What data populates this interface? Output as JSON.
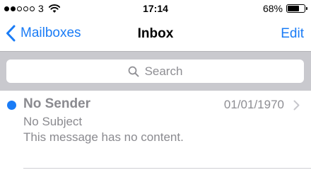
{
  "status_bar": {
    "signal_bars_filled": 2,
    "signal_bars_total": 5,
    "carrier": "3",
    "time": "17:14",
    "battery_percent": "68%",
    "battery_level": 0.68
  },
  "nav": {
    "back_label": "Mailboxes",
    "title": "Inbox",
    "edit_label": "Edit"
  },
  "search": {
    "placeholder": "Search"
  },
  "messages": [
    {
      "sender": "No Sender",
      "date": "01/01/1970",
      "subject": "No Subject",
      "preview": "This message has no content.",
      "unread": true
    }
  ],
  "colors": {
    "accent": "#1a7cf6",
    "search_background": "#c9c9ce",
    "secondary_text": "#8a8a8f"
  },
  "icons": {
    "back": "chevron-left-icon",
    "search": "magnifier-icon",
    "disclosure": "chevron-right-icon",
    "wifi": "wifi-icon",
    "battery": "battery-icon"
  }
}
